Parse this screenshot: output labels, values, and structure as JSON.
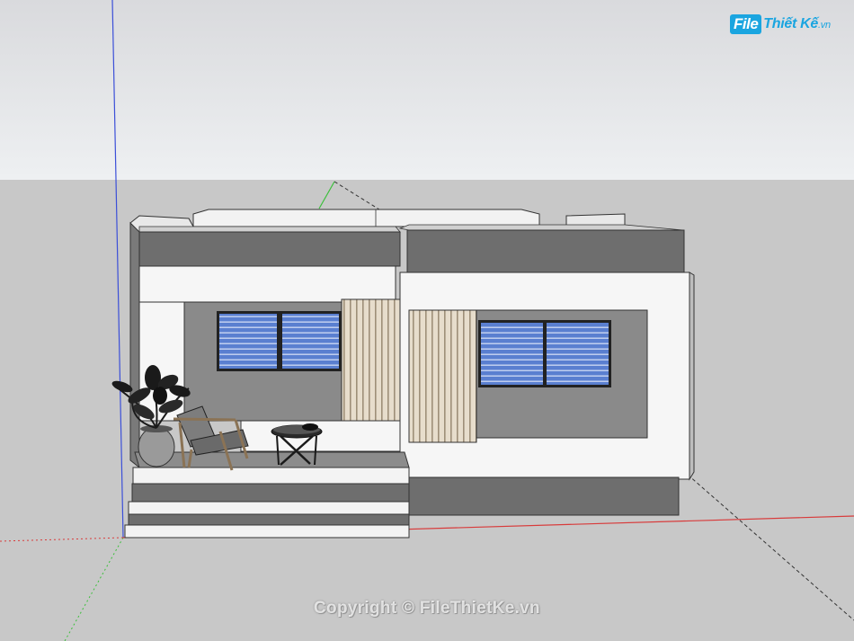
{
  "logo": {
    "box_text": "File",
    "text": "Thiết Kế",
    "suffix": ".vn",
    "color": "#1aa5e0"
  },
  "watermark": {
    "text": "Copyright © FileThietKe.vn"
  },
  "scene": {
    "sky_color": "#e4e5e7",
    "ground_color": "#c8c8c8",
    "axis_colors": {
      "blue_axis": "#3b4fd8",
      "red_axis": "#d83b3b",
      "green_axis": "#3bbf3b"
    },
    "wall_gray": "#8a8a8a",
    "wall_white": "#f6f6f6",
    "parapet_gray": "#6e6e6e",
    "glass_blue": "#5a7fd0",
    "slat_wood": "#cdbfa8"
  }
}
